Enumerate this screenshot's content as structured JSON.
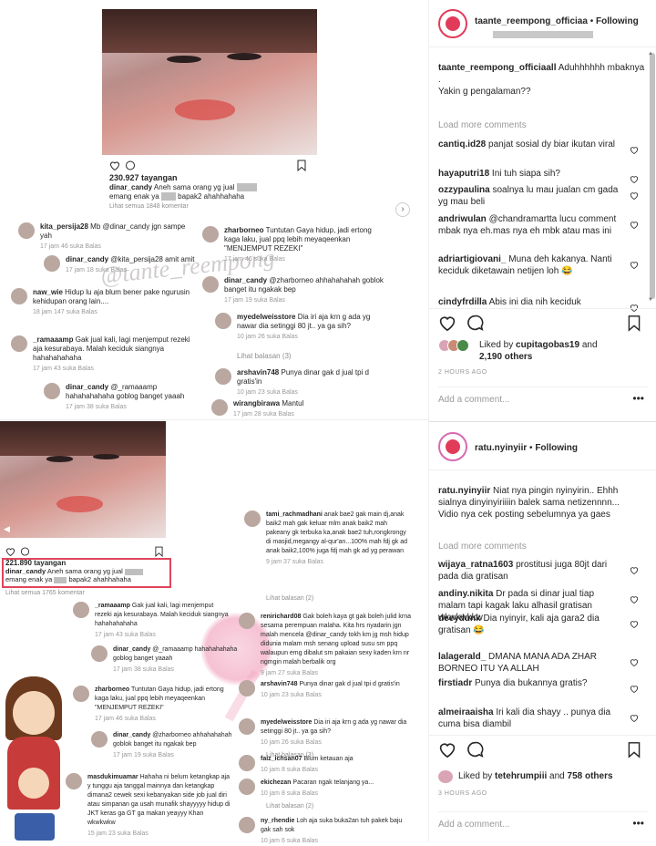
{
  "left": {
    "top_card": {
      "views": "230.927 tayangan",
      "caption_user": "dinar_candy",
      "caption_text": "Aneh sama orang yg jual",
      "caption_text_2": "emang enak ya",
      "caption_text_3": "bapak2 ahahhahaha",
      "view_all": "Lihat semua 1848 komentar"
    },
    "watermark": "@tante_reempong",
    "comments_top": [
      {
        "user": "kita_persija28",
        "text": "Mb @dinar_candy jgn sampe yah",
        "meta": "17 jam   46 suka   Balas"
      },
      {
        "user": "dinar_candy",
        "text": "@kita_persija28 amit amit",
        "meta": "17 jam   18 suka   Balas"
      },
      {
        "user": "naw_wie",
        "text": "Hidup lu aja blum bener pake ngurusin kehidupan orang lain....",
        "meta": "18 jam   147 suka   Balas"
      },
      {
        "user": "_ramaaamp",
        "text": "Gak jual kali, lagi menjemput rezeki aja kesurabaya. Malah keciduk siangnya hahahahahaha",
        "meta": "17 jam   43 suka   Balas"
      },
      {
        "user": "dinar_candy",
        "text": "@_ramaaamp hahahahahaha goblog banget yaaah",
        "meta": "17 jam   38 suka   Balas"
      }
    ],
    "comments_top_right": [
      {
        "user": "zharborneo",
        "text": "Tuntutan Gaya hidup, jadi ertong kaga laku, jual ppq lebih meyaqeenkan \"MENJEMPUT REZEKI\"",
        "meta": "17 jam   46 suka   Balas"
      },
      {
        "user": "dinar_candy",
        "text": "@zharborneo ahhahahahah goblok banget itu ngakak bep",
        "meta": "17 jam   19 suka   Balas"
      },
      {
        "user": "myedelweisstore",
        "text": "Dia iri aja krn g ada yg nawar dia setinggi 80 jt.. ya ga sih?",
        "meta": "10 jam   26 suka   Balas"
      },
      {
        "user": "",
        "text": "Lihat balasan (3)",
        "meta": ""
      },
      {
        "user": "arshavin748",
        "text": "Punya dinar gak d jual tpi d gratis'in",
        "meta": "10 jam   23 suka   Balas"
      },
      {
        "user": "wirangbirawa",
        "text": "Mantul",
        "meta": "17 jam   28 suka   Balas"
      }
    ],
    "bottom_card": {
      "views": "221.890 tayangan",
      "caption_user": "dinar_candy",
      "caption_text": "Aneh sama orang yg jual",
      "caption_text_2": "emang enak ya",
      "caption_text_3": "bapak2 ahahhahaha",
      "view_all": "Lihat semua 1765 komentar"
    },
    "comments_bottom": [
      {
        "user": "_ramaaamp",
        "text": "Gak jual kali, lagi menjemput rezeki aja kesurabaya. Malah keciduk siangnya hahahahahaha",
        "meta": "17 jam   43 suka   Balas"
      },
      {
        "user": "dinar_candy",
        "text": "@_ramaaamp hahahahahaha goblog banget yaaah",
        "meta": "17 jam   38 suka   Balas"
      },
      {
        "user": "zharborneo",
        "text": "Tuntutan Gaya hidup, jadi ertong kaga laku, jual ppq lebih meyaqeenkan \"MENJEMPUT REZEKI\"",
        "meta": "17 jam   46 suka   Balas"
      },
      {
        "user": "dinar_candy",
        "text": "@zharborneo ahhahahahah goblok banget itu ngakak bep",
        "meta": "17 jam   19 suka   Balas"
      },
      {
        "user": "masdukimuamar",
        "text": "Hahaha ni belum ketangkap aja y tunggu aja tanggal mainnya dan ketangkap dimana2 cewek sexi kebanyakan side job jual diri atau simpanan ga usah munafik shayyyyy hidup di JKT keras ga GT ga makan yeayyy Khan wkwkwkw",
        "meta": "15 jam   23 suka   Balas"
      }
    ],
    "comments_bottom_right": [
      {
        "user": "tami_rachmadhani",
        "text": "anak bae2 gak main dj,anak baik2 mah gak keluar mlm anak baik2 mah pakeany gk terbuka ka,anak bae2 tuh,rongkrongy di masjid,megangy al-qur'an...100% mah fdj gk ad anak baik2,100% juga fdj mah gk ad yg perawan",
        "meta": "9 jam   37 suka   Balas"
      },
      {
        "user": "",
        "text": "Lihat balasan (2)",
        "meta": ""
      },
      {
        "user": "renirichard08",
        "text": "Gak boleh kaya gt gak boleh julid krna sesama perempuan malaha. Kita hrs nyadarin jgn malah mencela @dinar_candy tokh km jg msh hidup didunia malam msh senang upload susu sm ppq walaupun emg dibalut sm pakaian sexy kaden krn nr ngmgin malah berbalik org",
        "meta": "9 jam   27 suka   Balas"
      },
      {
        "user": "arshavin748",
        "text": "Punya dinar gak d jual tpi d gratis'in",
        "meta": "10 jam   23 suka   Balas"
      },
      {
        "user": "myedelweisstore",
        "text": "Dia iri aja krn g ada yg nawar dia setinggi 80 jt.. ya ga sih?",
        "meta": "10 jam   26 suka   Balas"
      },
      {
        "user": "",
        "text": "Lihat balasan (3)",
        "meta": ""
      },
      {
        "user": "faiz_ichsan07",
        "text": "Blum ketauan aja",
        "meta": "10 jam   8 suka   Balas"
      },
      {
        "user": "ekichezan",
        "text": "Pacaran ngak telanjang ya...",
        "meta": "10 jam   8 suka   Balas"
      },
      {
        "user": "",
        "text": "Lihat balasan (2)",
        "meta": ""
      },
      {
        "user": "ny_rhendie",
        "text": "Loh aja suka buka2an tuh pakek baju gak sah sok",
        "meta": "10 jam   6 suka   Balas"
      }
    ]
  },
  "right": {
    "post1": {
      "username": "taante_reempong_officiaa",
      "follow": "Following",
      "caption_user": "taante_reempong_officiaall",
      "caption_text": "Aduhhhhhh mbaknya",
      "caption_dot": ".",
      "caption_text2": "Yakin g pengalaman??",
      "load_more": "Load more comments",
      "comments": [
        {
          "user": "cantiq.id28",
          "text": "panjat sosial dy biar ikutan viral"
        },
        {
          "user": "hayaputri18",
          "text": "Ini tuh siapa sih?"
        },
        {
          "user": "ozzypaulina",
          "text": "soalnya lu mau jualan cm gada yg mau beli"
        },
        {
          "user": "andriwulan",
          "text": "@chandramartta lucu comment mbak nya eh.mas nya eh mbk atau mas ini"
        },
        {
          "user": "adriartigiovani_",
          "text": "Muna deh kakanya. Nanti keciduk diketawain netijen loh 😂"
        },
        {
          "user": "cindyfrdilla",
          "text": "Abis ini dia nih keciduk"
        }
      ],
      "likes_prefix": "Liked by",
      "likes_user": "cupitagobas19",
      "likes_and": "and",
      "likes_count": "2,190 others",
      "time": "2 HOURS AGO",
      "add_comment": "Add a comment...",
      "more": "•••"
    },
    "post2": {
      "username": "ratu.nyinyiir",
      "follow": "Following",
      "caption_user": "ratu.nyinyiir",
      "caption_text": "Niat nya pingin nyinyirin.. Ehhh sialnya dinyinyiriiiin balek sama netizennnn...",
      "caption_text2": "Vidio nya cek posting sebelumnya ya gaes",
      "load_more": "Load more comments",
      "comments": [
        {
          "user": "wijaya_ratna1603",
          "text": "prostitusi juga 80jt dari pada dia gratisan"
        },
        {
          "user": "andiny.nikita",
          "text": "Dr pada si dinar jual tiap malam tapi kagak laku alhasil gratisan wkwkwkkw"
        },
        {
          "user": "deeydunk",
          "text": "Dia nyinyir, kali aja gara2 dia gratisan 😂"
        },
        {
          "user": "lalagerald_",
          "text": "DMANA MANA ADA ZHAR BORNEO ITU YA ALLAH"
        },
        {
          "user": "firstiadr",
          "text": "Punya dia bukannya gratis?"
        },
        {
          "user": "almeiraaisha",
          "text": "Iri kali dia shayy .. punya dia cuma bisa diambil"
        }
      ],
      "likes_prefix": "Liked by",
      "likes_user": "tetehrumpiii",
      "likes_and": "and",
      "likes_count": "758 others",
      "time": "3 HOURS AGO",
      "add_comment": "Add a comment...",
      "more": "•••"
    }
  },
  "colors": {
    "accent": "#e0455b",
    "link": "#003569",
    "muted": "#8e8e8e"
  }
}
